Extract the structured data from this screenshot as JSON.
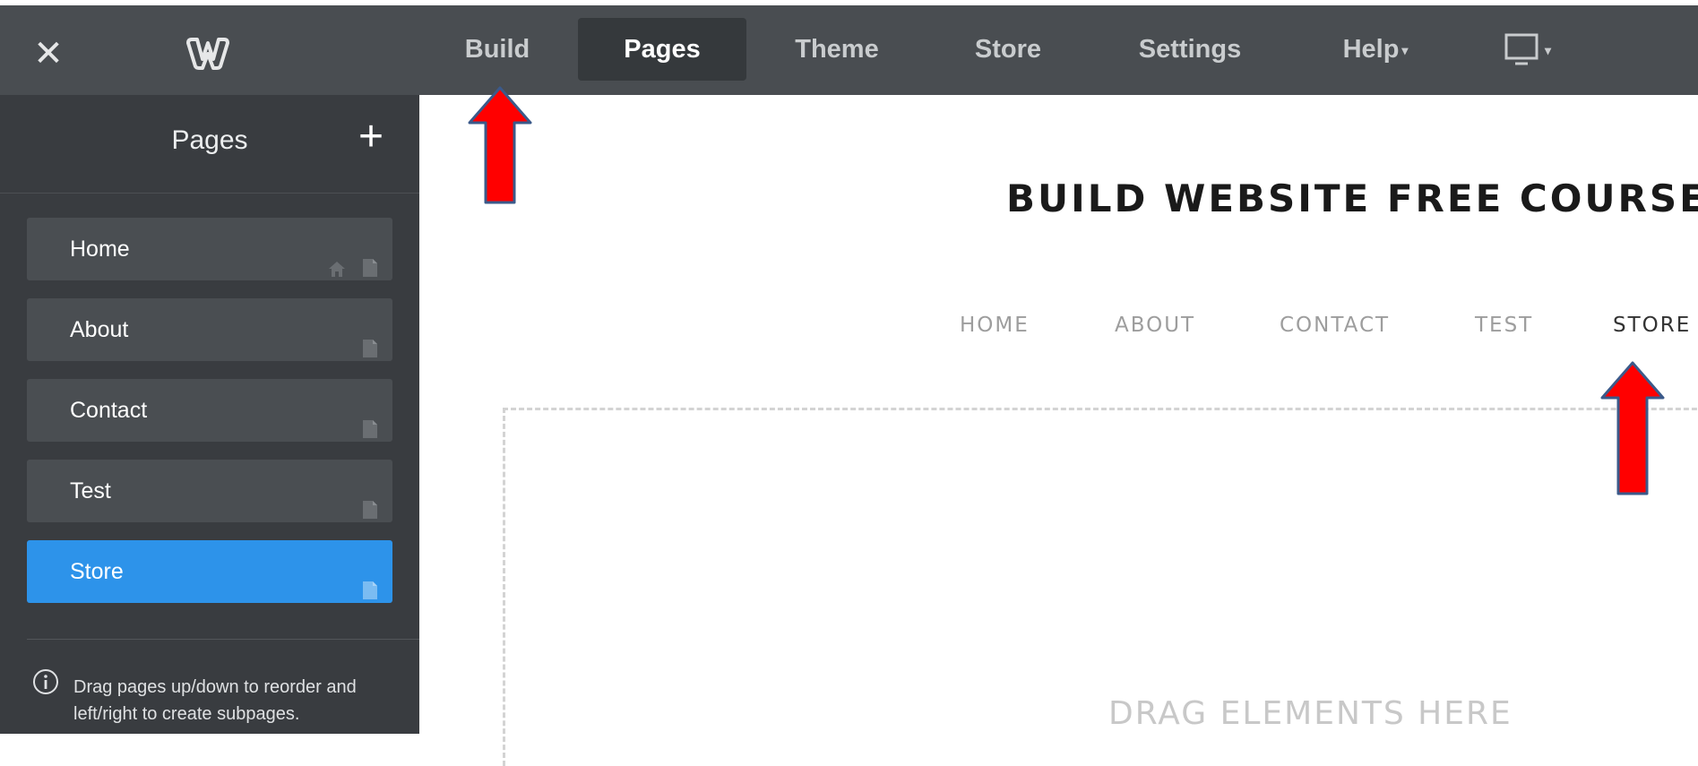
{
  "topbar": {
    "close_label": "✕",
    "tabs": [
      {
        "label": "Build"
      },
      {
        "label": "Pages"
      },
      {
        "label": "Theme"
      },
      {
        "label": "Store"
      },
      {
        "label": "Settings"
      },
      {
        "label": "Help"
      }
    ],
    "active_tab": "Pages",
    "logo_icon": "weebly-w-icon",
    "device_icon": "desktop-monitor-icon"
  },
  "sidebar": {
    "title": "Pages",
    "add_label": "+",
    "pages": [
      {
        "label": "Home",
        "icons": [
          "home-icon",
          "page-icon"
        ]
      },
      {
        "label": "About",
        "icons": [
          "page-icon"
        ]
      },
      {
        "label": "Contact",
        "icons": [
          "page-icon"
        ]
      },
      {
        "label": "Test",
        "icons": [
          "page-icon"
        ]
      },
      {
        "label": "Store",
        "icons": [
          "page-icon"
        ],
        "selected": true
      }
    ],
    "help_text": "Drag pages up/down to reorder and left/right to create subpages."
  },
  "site": {
    "title": "BUILD WEBSITE FREE COURSE",
    "nav": [
      "HOME",
      "ABOUT",
      "CONTACT",
      "TEST",
      "STORE"
    ],
    "current_nav": "STORE",
    "drop_text": "DRAG ELEMENTS HERE"
  },
  "colors": {
    "topbar": "#494d51",
    "sidebar": "#393c40",
    "selected_page": "#2d93ea",
    "annotation_arrow": "#ff0000",
    "annotation_arrow_border": "#3b5a8a"
  }
}
